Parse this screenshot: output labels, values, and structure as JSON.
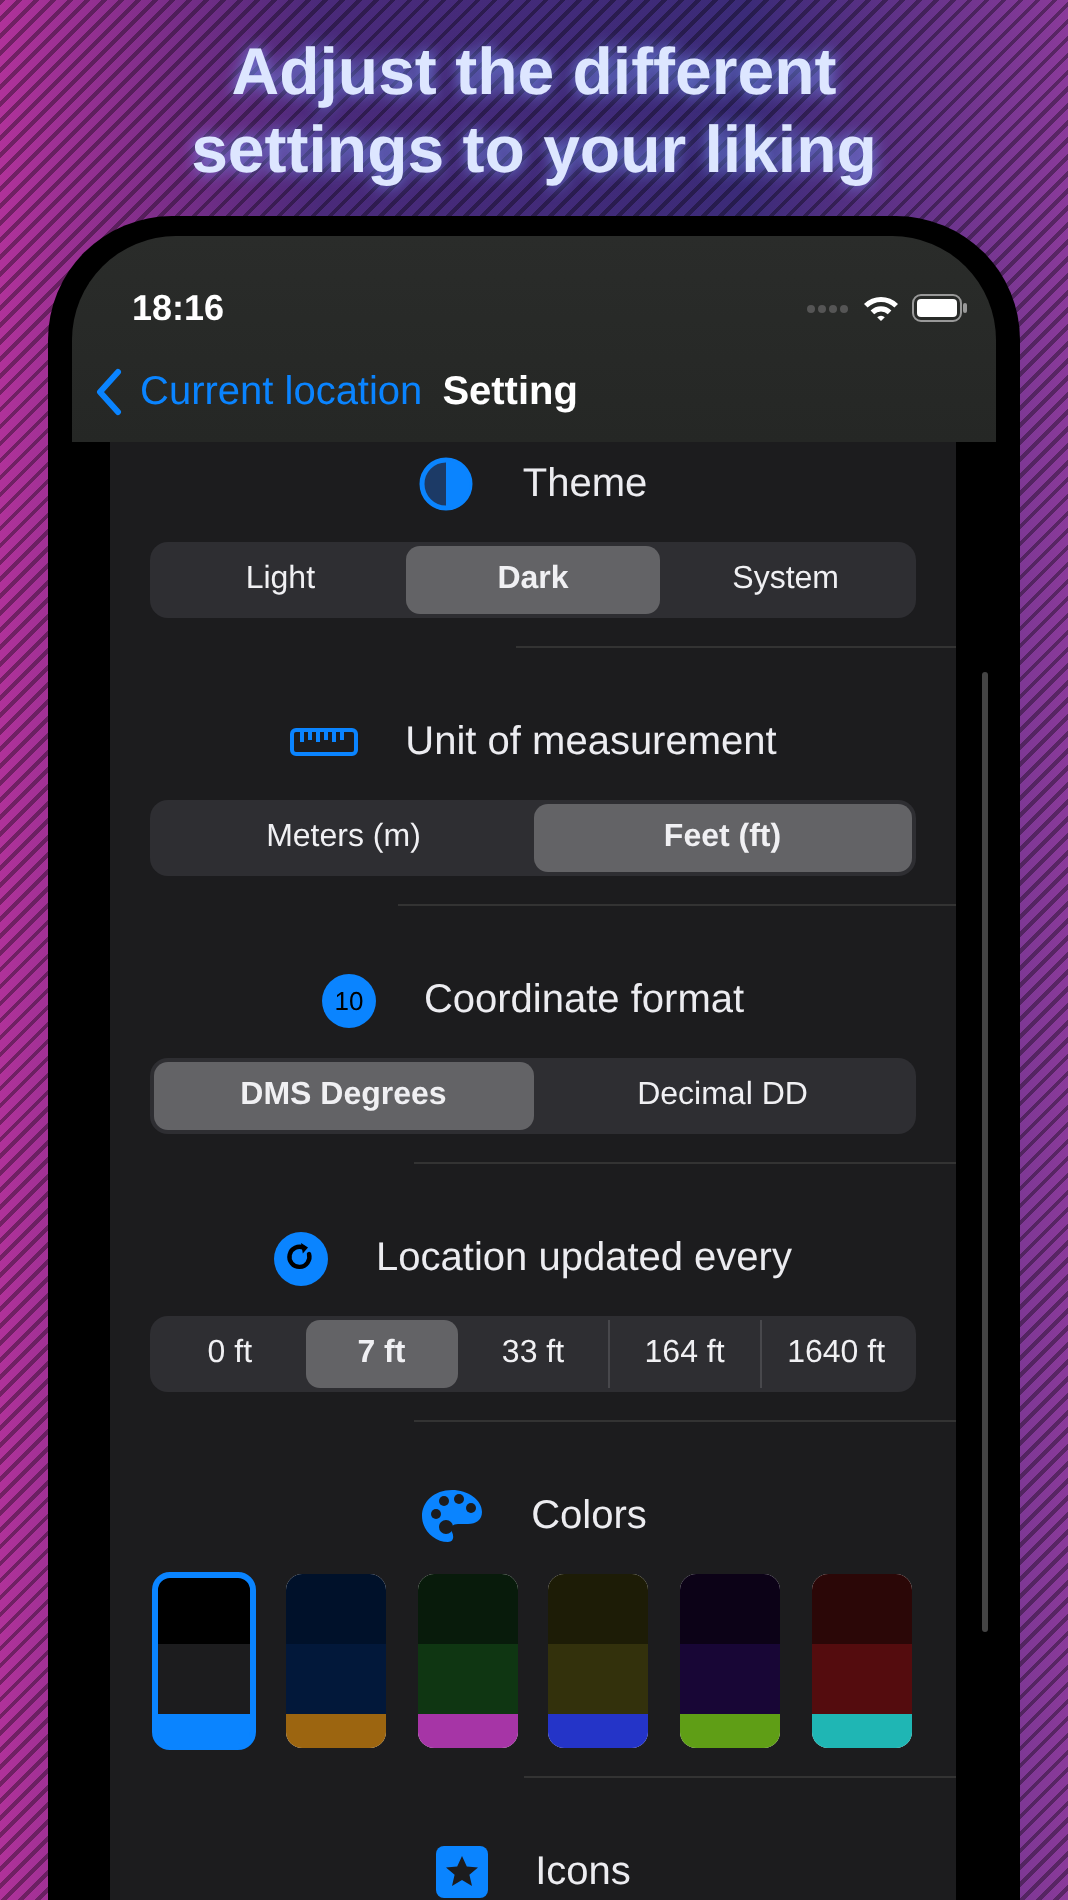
{
  "headline": "Adjust the different settings to your liking",
  "status_bar": {
    "time": "18:16"
  },
  "nav": {
    "back": "Current location",
    "title": "Setting"
  },
  "sections": [
    {
      "kind": "segmented",
      "title": "Theme",
      "options": [
        {
          "label": "Light",
          "selected": false
        },
        {
          "label": "Dark",
          "selected": true
        },
        {
          "label": "System",
          "selected": false
        }
      ]
    },
    {
      "kind": "segmented",
      "title": "Unit of measurement",
      "options": [
        {
          "label": "Meters (m)",
          "selected": false
        },
        {
          "label": "Feet (ft)",
          "selected": true
        }
      ]
    },
    {
      "kind": "segmented",
      "title": "Coordinate format",
      "badge": "10",
      "options": [
        {
          "label": "DMS Degrees",
          "selected": true
        },
        {
          "label": "Decimal DD",
          "selected": false
        }
      ]
    },
    {
      "kind": "segmented",
      "title": "Location updated every",
      "options": [
        {
          "label": "0 ft",
          "selected": false
        },
        {
          "label": "7 ft",
          "selected": true
        },
        {
          "label": "33 ft",
          "selected": false
        },
        {
          "label": "164 ft",
          "selected": false
        },
        {
          "label": "1640 ft",
          "selected": false
        }
      ]
    },
    {
      "kind": "swatches",
      "title": "Colors",
      "swatches": [
        {
          "selected": true,
          "bands": [
            {
              "color": "#000000"
            },
            {
              "color": "#1c1c1e"
            },
            {
              "color": "#0a84ff"
            }
          ]
        },
        {
          "selected": false,
          "bands": [
            {
              "color": "#00112a"
            },
            {
              "color": "#02183a"
            },
            {
              "color": "#9c6510"
            }
          ]
        },
        {
          "selected": false,
          "bands": [
            {
              "color": "#081b0b"
            },
            {
              "color": "#0f3612"
            },
            {
              "color": "#a635a6"
            }
          ]
        },
        {
          "selected": false,
          "bands": [
            {
              "color": "#1d1c06"
            },
            {
              "color": "#33310c"
            },
            {
              "color": "#2434c8"
            }
          ]
        },
        {
          "selected": false,
          "bands": [
            {
              "color": "#0c0217"
            },
            {
              "color": "#180636"
            },
            {
              "color": "#5f9e16"
            }
          ]
        },
        {
          "selected": false,
          "bands": [
            {
              "color": "#2b0707"
            },
            {
              "color": "#540c0e"
            },
            {
              "color": "#1fb6b4"
            }
          ]
        }
      ]
    },
    {
      "kind": "header",
      "title": "Icons"
    }
  ]
}
